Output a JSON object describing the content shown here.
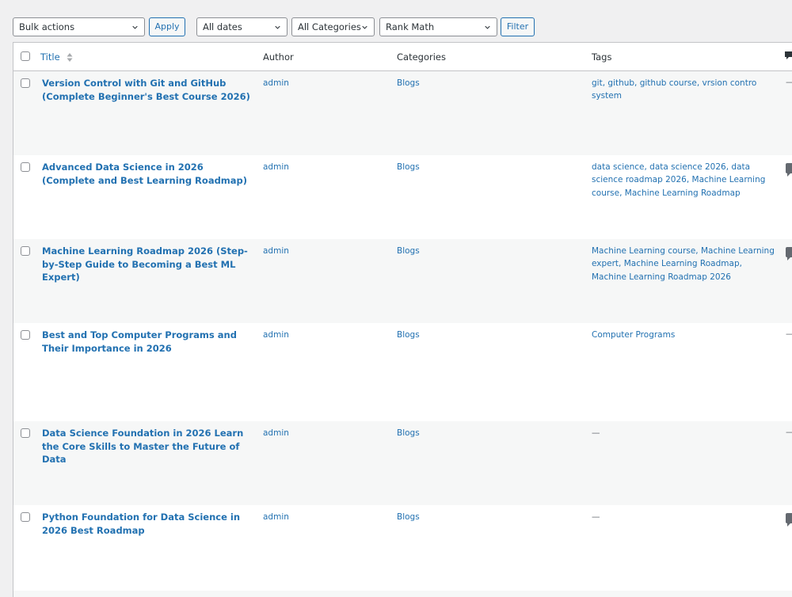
{
  "toolbar": {
    "bulk_actions": "Bulk actions",
    "apply": "Apply",
    "dates": "All dates",
    "categories": "All Categories",
    "seo": "Rank Math",
    "filter": "Filter"
  },
  "columns": {
    "title": "Title",
    "author": "Author",
    "categories": "Categories",
    "tags": "Tags"
  },
  "posts": [
    {
      "title": "Version Control with Git and GitHub (Complete Beginner's Best Course 2026)",
      "author": "admin",
      "category": "Blogs",
      "tags": "git, github, github course, vrsion contro system",
      "comments": "—"
    },
    {
      "title": "Advanced Data Science in 2026 (Complete and Best Learning Roadmap)",
      "author": "admin",
      "category": "Blogs",
      "tags": "data science, data science 2026, data science roadmap 2026, Machine Learning course, Machine Learning Roadmap",
      "comments": ""
    },
    {
      "title": "Machine Learning Roadmap 2026 (Step-by-Step Guide to Becoming a Best ML Expert)",
      "author": "admin",
      "category": "Blogs",
      "tags": "Machine Learning course, Machine Learning expert, Machine Learning Roadmap, Machine Learning Roadmap 2026",
      "comments": ""
    },
    {
      "title": "Best and Top Computer Programs and Their Importance in 2026",
      "author": "admin",
      "category": "Blogs",
      "tags": "Computer Programs",
      "comments": "—"
    },
    {
      "title": "Data Science Foundation in 2026 Learn the Core Skills to Master the Future of Data",
      "author": "admin",
      "category": "Blogs",
      "tags": "—",
      "comments": "—"
    },
    {
      "title": "Python Foundation for Data Science in 2026 Best Roadmap",
      "author": "admin",
      "category": "Blogs",
      "tags": "—",
      "comments": ""
    }
  ],
  "icons": {
    "chevron": "chevron-down-icon",
    "sort": "sort-icon",
    "comment": "comment-bubble-icon"
  },
  "colors": {
    "link": "#2271b1",
    "border": "#c3c4c7",
    "alt_row": "#f6f7f7",
    "bubble": "#646970"
  }
}
